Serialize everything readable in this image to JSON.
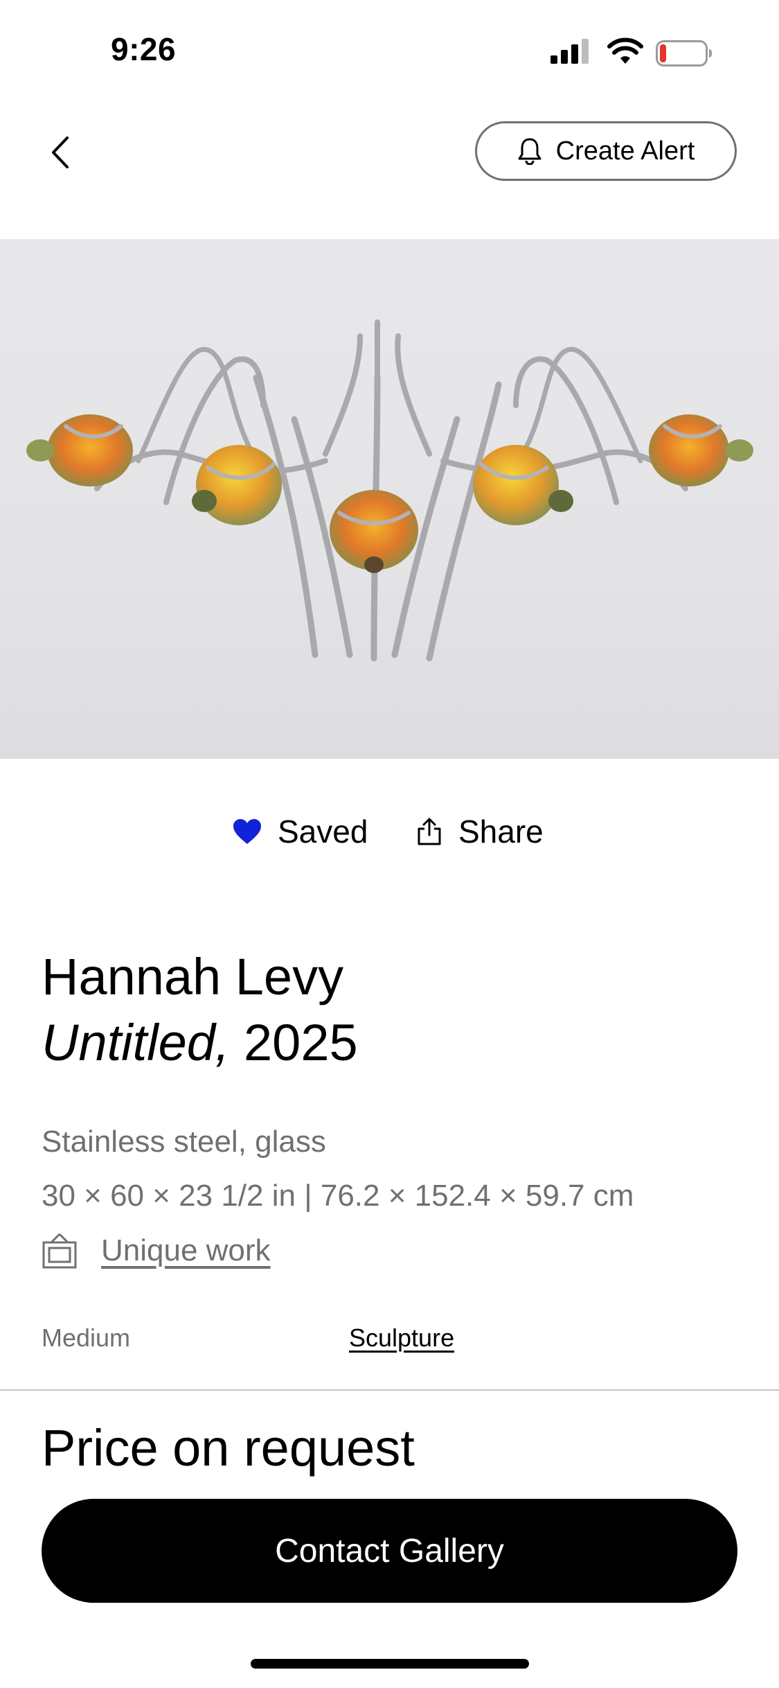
{
  "status_bar": {
    "time": "9:26",
    "icons": [
      "cellular-signal-icon",
      "wifi-icon",
      "battery-low-icon"
    ],
    "battery_color": "#e5352b"
  },
  "header": {
    "back_icon": "chevron-left-icon",
    "create_alert_label": "Create Alert",
    "create_alert_icon": "bell-icon"
  },
  "artwork_image": {
    "background": "#e6e6e8"
  },
  "actions": {
    "save_label": "Saved",
    "save_icon": "heart-filled-icon",
    "save_color": "#1023d7",
    "share_label": "Share",
    "share_icon": "share-icon"
  },
  "artwork": {
    "artist": "Hannah Levy",
    "title": "Untitled,",
    "year": "2025",
    "materials": "Stainless steel, glass",
    "dimensions": "30 × 60 × 23 1/2 in | 76.2 × 152.4 × 59.7 cm",
    "rarity_icon": "frame-icon",
    "rarity": "Unique work",
    "medium_label": "Medium",
    "medium_value": "Sculpture"
  },
  "purchase": {
    "price": "Price on request",
    "contact_label": "Contact Gallery"
  }
}
